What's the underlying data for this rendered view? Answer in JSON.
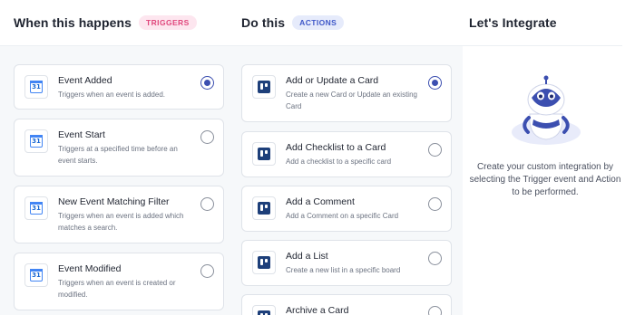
{
  "triggers": {
    "heading": "When this happens",
    "badge": "TRIGGERS",
    "items": [
      {
        "title": "Event Added",
        "desc": "Triggers when an event is added.",
        "selected": true,
        "icon": "google-calendar-icon"
      },
      {
        "title": "Event Start",
        "desc": "Triggers at a specified time before an event starts.",
        "selected": false,
        "icon": "google-calendar-icon"
      },
      {
        "title": "New Event Matching Filter",
        "desc": "Triggers when an event is added which matches a search.",
        "selected": false,
        "icon": "google-calendar-icon"
      },
      {
        "title": "Event Modified",
        "desc": "Triggers when an event is created or modified.",
        "selected": false,
        "icon": "google-calendar-icon"
      }
    ]
  },
  "actions": {
    "heading": "Do this",
    "badge": "ACTIONS",
    "items": [
      {
        "title": "Add or Update a Card",
        "desc": "Create a new Card or Update an existing Card",
        "selected": true,
        "icon": "trello-icon"
      },
      {
        "title": "Add Checklist to a Card",
        "desc": "Add a checklist to a specific card",
        "selected": false,
        "icon": "trello-icon"
      },
      {
        "title": "Add a Comment",
        "desc": "Add a Comment on a specific Card",
        "selected": false,
        "icon": "trello-icon"
      },
      {
        "title": "Add a List",
        "desc": "Create a new list in a specific board",
        "selected": false,
        "icon": "trello-icon"
      },
      {
        "title": "Archive a Card",
        "desc": "",
        "selected": false,
        "icon": "trello-icon"
      }
    ]
  },
  "integrate": {
    "heading": "Let's Integrate",
    "message": "Create your custom integration by selecting the Trigger event and Action to be performed.",
    "illustration": "robot-icon"
  },
  "calendar_icon_text": "31",
  "colors": {
    "accent": "#3c4fb0",
    "trigger_pill_bg": "#fde6ef",
    "trigger_pill_text": "#e0467c",
    "action_pill_bg": "#e6ebfb",
    "action_pill_text": "#3e57c8"
  }
}
